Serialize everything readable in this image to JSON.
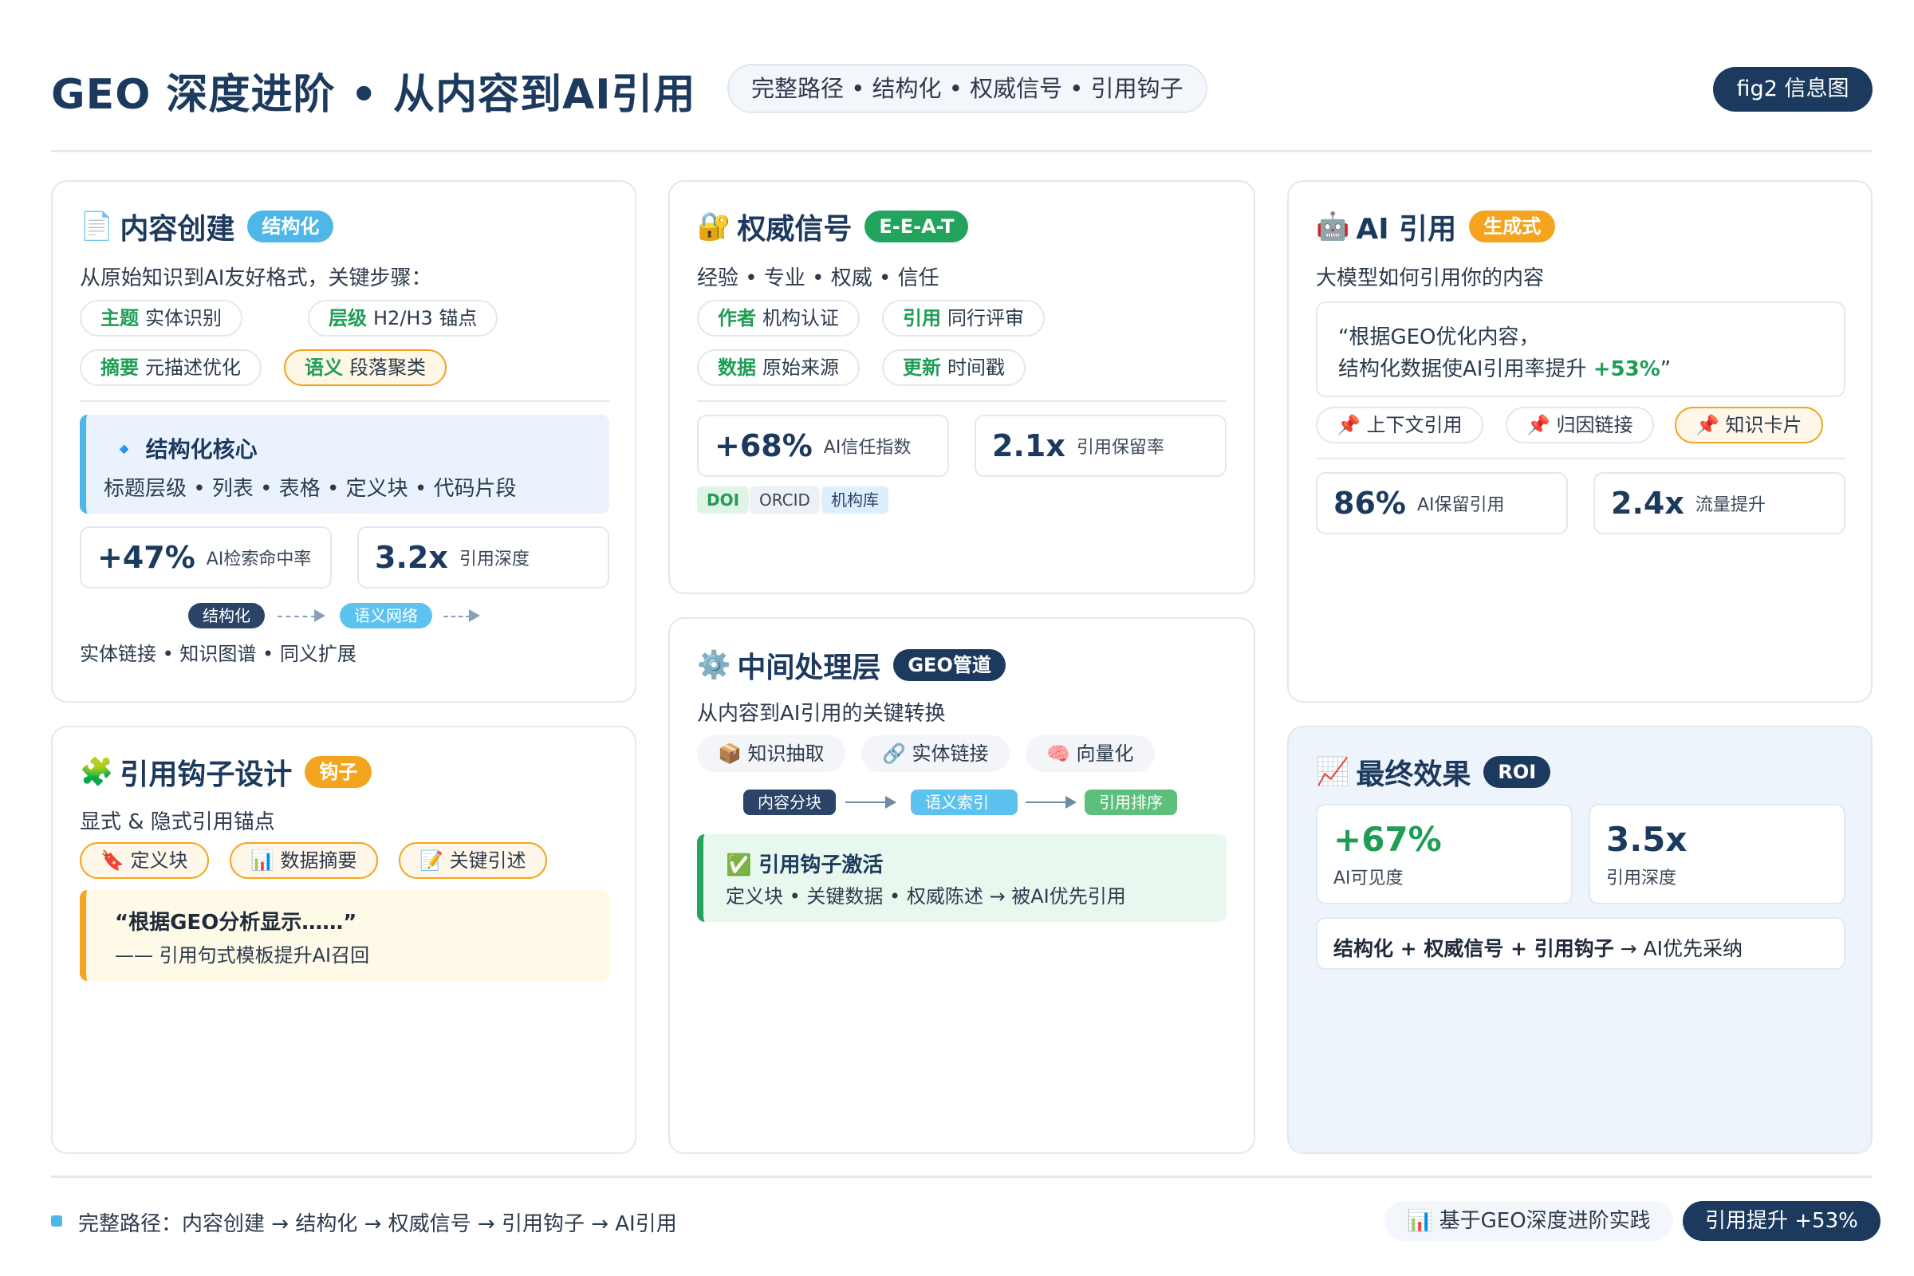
{
  "header": {
    "title": "GEO 深度进阶 • 从内容到AI引用",
    "subtitle": "完整路径 • 结构化 • 权威信号 • 引用钩子",
    "fig_label": "fig2 信息图"
  },
  "content_creation": {
    "icon": "📄",
    "title": "内容创建",
    "tag": "结构化",
    "desc": "从原始知识到AI友好格式，关键步骤：",
    "chips": [
      {
        "key": "主题",
        "text": "实体识别"
      },
      {
        "key": "层级",
        "text": "H2/H3 锚点"
      },
      {
        "key": "摘要",
        "text": "元描述优化"
      },
      {
        "key": "语义",
        "text": "段落聚类"
      }
    ],
    "core_title": "🔹 结构化核心",
    "core_text": "标题层级 • 列表 • 表格 • 定义块 • 代码片段",
    "stats": [
      {
        "value": "+47%",
        "label": "AI检索命中率"
      },
      {
        "value": "3.2x",
        "label": "引用深度"
      }
    ],
    "flow": [
      "结构化",
      "语义网络"
    ],
    "footer": "实体链接 • 知识图谱 • 同义扩展"
  },
  "authority": {
    "icon": "🔐",
    "title": "权威信号",
    "tag": "E-E-A-T",
    "desc": "经验 • 专业 • 权威 • 信任",
    "chips": [
      {
        "key": "作者",
        "text": "机构认证"
      },
      {
        "key": "引用",
        "text": "同行评审"
      },
      {
        "key": "数据",
        "text": "原始来源"
      },
      {
        "key": "更新",
        "text": "时间戳"
      }
    ],
    "stats": [
      {
        "value": "+68%",
        "label": "AI信任指数"
      },
      {
        "value": "2.1x",
        "label": "引用保留率"
      }
    ],
    "badges": [
      "DOI",
      "ORCID",
      "机构库"
    ]
  },
  "ai_citation": {
    "icon": "🤖",
    "title": "AI 引用",
    "tag": "生成式",
    "desc": "大模型如何引用你的内容",
    "quote_line1": "“根据GEO优化内容，",
    "quote_line2": "结构化数据使AI引用率提升 ",
    "quote_highlight": "+53%",
    "quote_end": "”",
    "chips": [
      "📌 上下文引用",
      "📌 归因链接",
      "📌 知识卡片"
    ],
    "stats": [
      {
        "value": "86%",
        "label": "AI保留引用"
      },
      {
        "value": "2.4x",
        "label": "流量提升"
      }
    ]
  },
  "middle_layer": {
    "icon": "⚙️",
    "title": "中间处理层",
    "tag": "GEO管道",
    "desc": "从内容到AI引用的关键转换",
    "chips": [
      "📦 知识抽取",
      "🔗 实体链接",
      "🧠 向量化"
    ],
    "flow": [
      "内容分块",
      "语义索引",
      "引用排序"
    ],
    "hook_title": "✅ 引用钩子激活",
    "hook_text": "定义块 • 关键数据 • 权威陈述 → 被AI优先引用"
  },
  "hook_design": {
    "icon": "🧩",
    "title": "引用钩子设计",
    "tag": "钩子",
    "desc": "显式 & 隐式引用锚点",
    "chips": [
      "🔖 定义块",
      "📊 数据摘要",
      "📝 关键引述"
    ],
    "quote": "“根据GEO分析显示……”",
    "quote_note": "—— 引用句式模板提升AI召回"
  },
  "final_effect": {
    "icon": "📈",
    "title": "最终效果",
    "tag": "ROI",
    "stats": [
      {
        "value": "+67%",
        "label": "AI可见度"
      },
      {
        "value": "3.5x",
        "label": "引用深度"
      }
    ],
    "summary_bold": "结构化 + 权威信号 + 引用钩子",
    "summary_rest": " → AI优先采纳"
  },
  "footer": {
    "path": "完整路径：内容创建 → 结构化 → 权威信号 → 引用钩子 → AI引用",
    "source": "📊 基于GEO深度进阶实践",
    "result": "引用提升 +53%"
  },
  "colors": {
    "navy": "#1c3a5e",
    "sky": "#4fb6e8",
    "green": "#22a45d",
    "orange": "#f4a41f"
  }
}
